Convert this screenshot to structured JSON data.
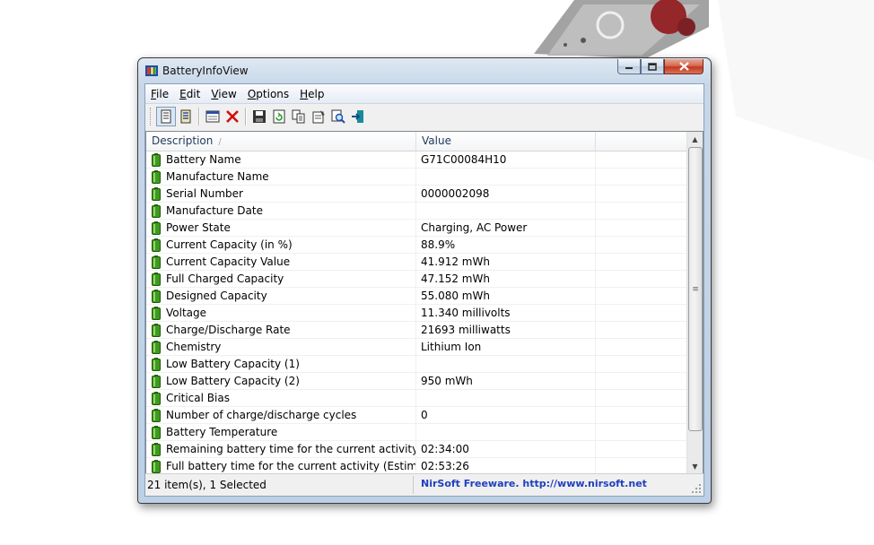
{
  "window": {
    "title": "BatteryInfoView"
  },
  "menu": [
    "File",
    "Edit",
    "View",
    "Options",
    "Help"
  ],
  "toolbar": {
    "icons": [
      "properties-view-icon",
      "list-view-icon",
      "html-report-icon",
      "delete-icon",
      "save-icon",
      "refresh-icon",
      "copy-icon",
      "properties-icon",
      "find-icon",
      "exit-icon"
    ]
  },
  "columns": {
    "description": "Description",
    "value": "Value"
  },
  "rows": [
    {
      "desc": "Battery Name",
      "value": "G71C00084H10"
    },
    {
      "desc": "Manufacture Name",
      "value": ""
    },
    {
      "desc": "Serial Number",
      "value": "0000002098"
    },
    {
      "desc": "Manufacture Date",
      "value": ""
    },
    {
      "desc": "Power State",
      "value": "Charging, AC Power"
    },
    {
      "desc": "Current Capacity (in %)",
      "value": "88.9%"
    },
    {
      "desc": "Current Capacity Value",
      "value": "41.912 mWh"
    },
    {
      "desc": "Full Charged Capacity",
      "value": "47.152 mWh"
    },
    {
      "desc": "Designed Capacity",
      "value": "55.080 mWh"
    },
    {
      "desc": "Voltage",
      "value": "11.340 millivolts"
    },
    {
      "desc": "Charge/Discharge Rate",
      "value": "21693 milliwatts"
    },
    {
      "desc": "Chemistry",
      "value": "Lithium Ion"
    },
    {
      "desc": "Low Battery Capacity (1)",
      "value": ""
    },
    {
      "desc": "Low Battery Capacity (2)",
      "value": "950 mWh"
    },
    {
      "desc": "Critical Bias",
      "value": ""
    },
    {
      "desc": "Number of charge/discharge cycles",
      "value": "0"
    },
    {
      "desc": "Battery Temperature",
      "value": ""
    },
    {
      "desc": "Remaining battery time for the current activity (Est...",
      "value": "02:34:00"
    },
    {
      "desc": "Full battery time for the current activity (Estimated)",
      "value": "02:53:26"
    }
  ],
  "status": {
    "items": "21 item(s), 1 Selected",
    "link": "NirSoft Freeware.  http://www.nirsoft.net"
  },
  "colors": {
    "battery_green": "#3f9a1e",
    "link_blue": "#1f3fbf"
  }
}
